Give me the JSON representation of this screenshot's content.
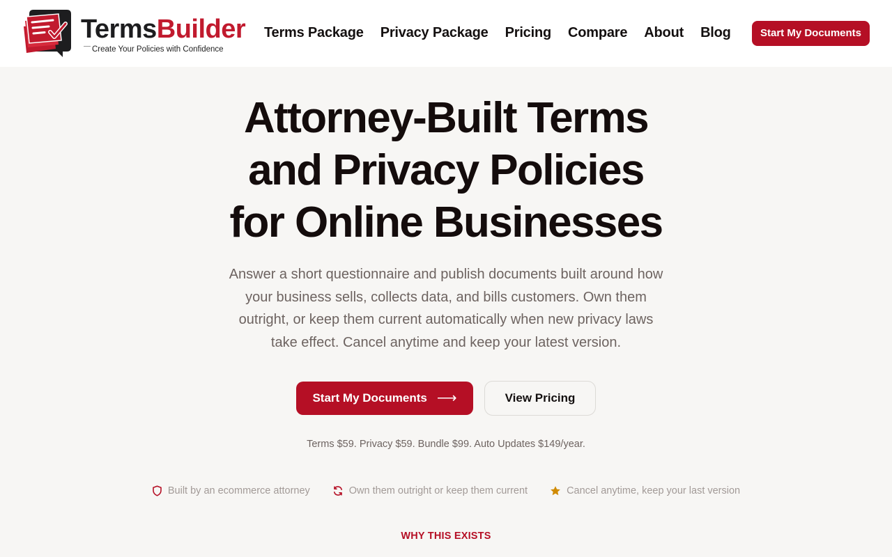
{
  "brand": {
    "name_part1": "Terms",
    "name_part2": "Builder",
    "tagline": "Create Your Policies with Confidence",
    "primary_color": "#b50f25",
    "logo_icon": "document-check-icon"
  },
  "nav": {
    "items": [
      "Terms Package",
      "Privacy Package",
      "Pricing",
      "Compare",
      "About",
      "Blog"
    ],
    "cta_label": "Start My Documents"
  },
  "hero": {
    "title_lines": [
      "Attorney-Built Terms",
      "and Privacy Policies",
      "for Online Businesses"
    ],
    "subtitle_lines": [
      "Answer a short questionnaire and publish documents built around how",
      "your business sells, collects data, and bills customers. Own them",
      "outright, or keep them current automatically when new privacy laws",
      "take effect. Cancel anytime and keep your latest version."
    ],
    "primary_cta": "Start My Documents",
    "primary_cta_icon": "arrow-right-icon",
    "secondary_cta": "View Pricing",
    "price_line": "Terms $59. Privacy $59. Bundle $99. Auto Updates $149/year."
  },
  "trust": [
    {
      "icon": "shield-icon",
      "text": "Built by an ecommerce attorney",
      "color": "#b50f25"
    },
    {
      "icon": "refresh-icon",
      "text": "Own them outright or keep them current",
      "color": "#b50f25"
    },
    {
      "icon": "star-icon",
      "text": "Cancel anytime, keep your last version",
      "color": "#d08a00"
    }
  ],
  "section": {
    "eyebrow": "WHY THIS EXISTS"
  }
}
